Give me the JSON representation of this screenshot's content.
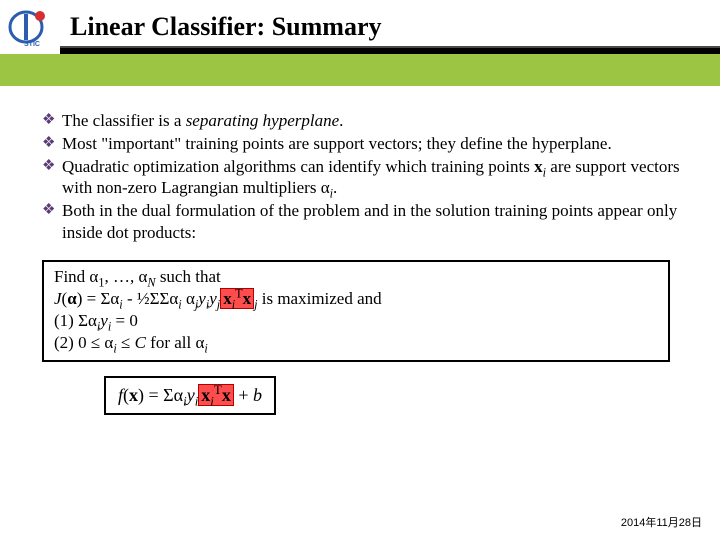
{
  "header": {
    "title": "Linear Classifier: Summary"
  },
  "bullets": {
    "b1_pre": "The classifier is a ",
    "b1_em": "separating hyperplane",
    "b1_post": ".",
    "b2": "Most \"important\" training points are support vectors; they define the hyperplane.",
    "b3_a": "Quadratic optimization algorithms can identify which training points ",
    "b3_b": " are support vectors with non-zero Lagrangian multipliers α",
    "b3_c": ".",
    "b4": "Both in the dual formulation of the problem and in the solution training points appear only inside dot products:"
  },
  "box1": {
    "l1_a": "Find α",
    "l1_b": ", …, α",
    "l1_c": " such that",
    "l2_a": "(",
    "l2_b": ") = Σα",
    "l2_c": " - ½ΣΣα",
    "l2_d": " α",
    "l2_e": " is maximized and",
    "l3_a": "(1) Σα",
    "l3_b": " = 0",
    "l4_a": "(2)  0 ≤ α",
    "l4_b": " ≤ ",
    "l4_c": " for all α"
  },
  "box2": {
    "a": "(",
    "b": ") = Σα",
    "c": " + ",
    "d": "b"
  },
  "sym": {
    "x": "x",
    "xi": "i",
    "xj": "j",
    "yi": "y",
    "yj": "y",
    "J": "J",
    "alpha_bold": "α",
    "T": "T",
    "N": "N",
    "C": "C",
    "f": "f",
    "one": "1",
    "i": "i",
    "j": "j"
  },
  "footer": {
    "date": "2014年11月28日"
  }
}
